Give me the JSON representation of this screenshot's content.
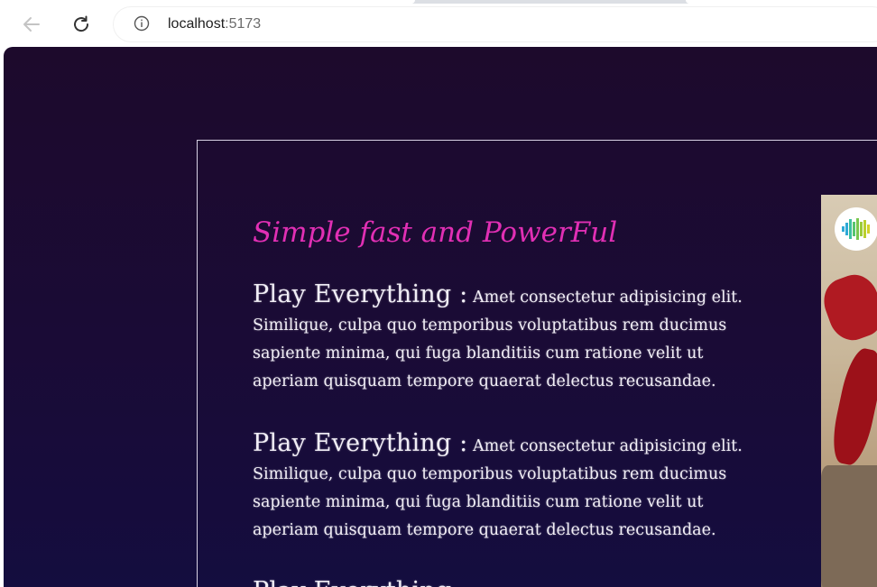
{
  "browser": {
    "url_host": "localhost",
    "url_port": ":5173",
    "icons": {
      "back": "arrow-left-icon",
      "reload": "reload-icon",
      "site_info": "info-icon"
    }
  },
  "card": {
    "title": "Simple fast and PowerFul",
    "title_color": "#e12fb4",
    "features": [
      {
        "heading": "Play Everything :",
        "text": " Amet consectetur adipisicing elit. Similique, culpa quo temporibus voluptatibus rem ducimus sapiente minima, qui fuga blanditiis cum ratione velit ut aperiam quisquam tempore quaerat delectus recusandae."
      },
      {
        "heading": "Play Everything :",
        "text": " Amet consectetur adipisicing elit. Similique, culpa quo temporibus voluptatibus rem ducimus sapiente minima, qui fuga blanditiis cum ratione velit ut aperiam quisquam tempore quaerat delectus recusandae."
      },
      {
        "heading": "Play Everything :",
        "text": ""
      }
    ]
  },
  "colors": {
    "page_background": "#1d0a2c",
    "card_border": "#d8d2e4",
    "text": "#f1eef6"
  }
}
